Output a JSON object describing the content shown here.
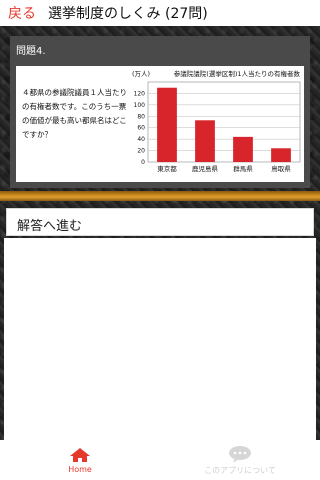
{
  "header": {
    "back_label": "戻る",
    "title": "選挙制度のしくみ (27問)"
  },
  "question": {
    "label": "問題4.",
    "text": "４都県の参議院議員１人当たりの有権者数です。このうち一票の価値が最も高い都県名はどこですか？"
  },
  "chart_data": {
    "type": "bar",
    "title": "参議院議院(選挙区制)1人当たりの有権者数",
    "ylabel": "(万人)",
    "categories": [
      "東京都",
      "鹿児島県",
      "群馬県",
      "鳥取県"
    ],
    "values": [
      130,
      73,
      44,
      24
    ],
    "ylim": [
      0,
      140
    ],
    "yticks": [
      0,
      20,
      40,
      60,
      80,
      100,
      120
    ],
    "grid": true,
    "bar_color": "#d8252b"
  },
  "answer": {
    "button_label": "解答へ進む"
  },
  "bottom_nav": {
    "items": [
      {
        "label": "Home",
        "icon": "home-icon",
        "color": "#e5392d"
      },
      {
        "label": "このアプリについて",
        "icon": "chat-bubble-icon",
        "color": "#cfcfcf"
      }
    ]
  }
}
